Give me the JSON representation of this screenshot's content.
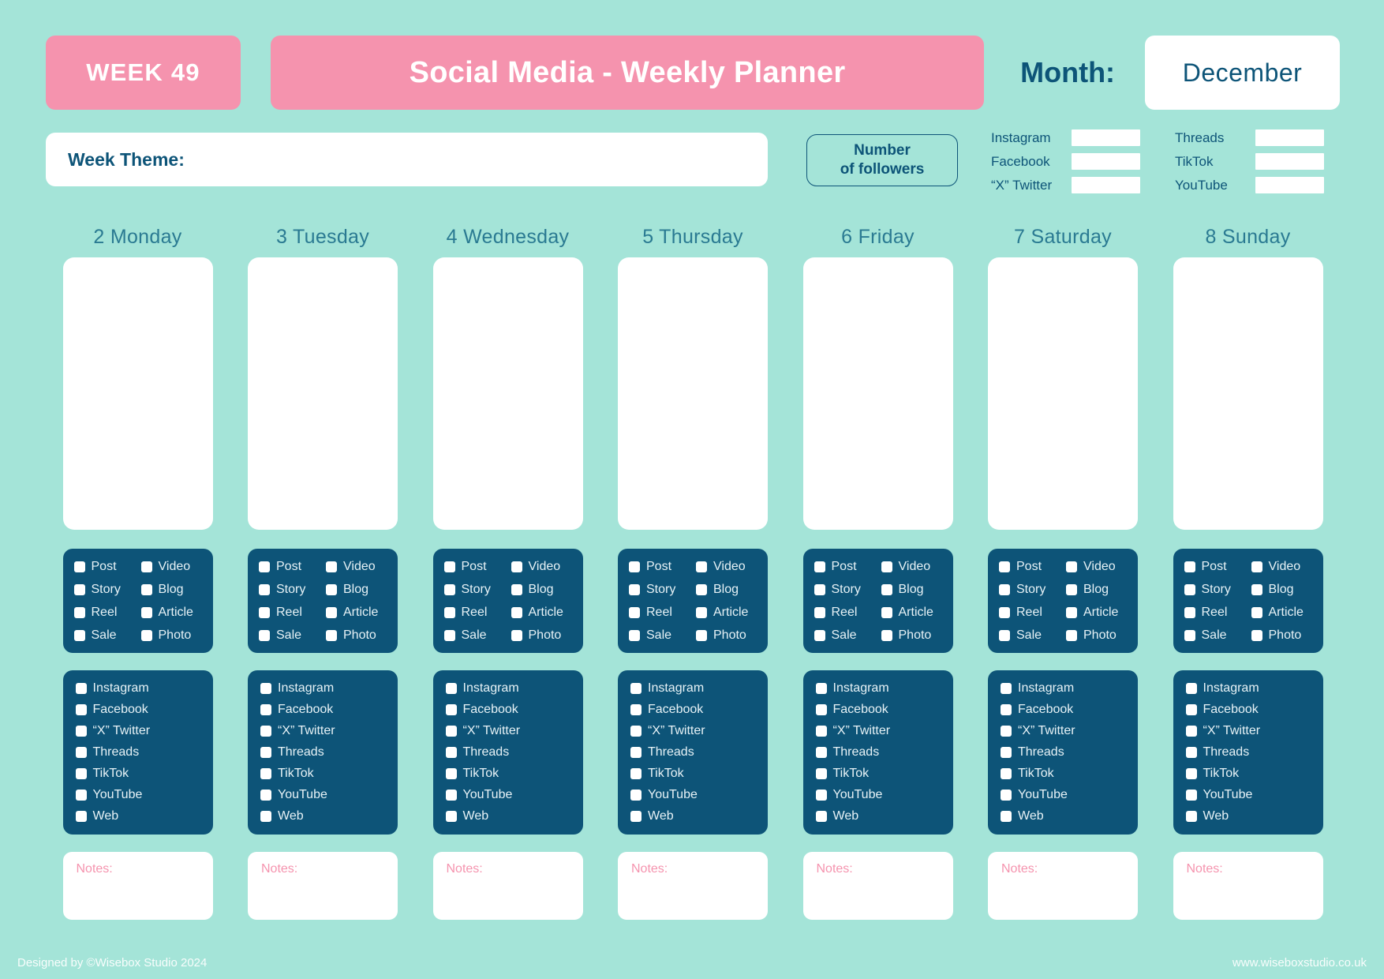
{
  "header": {
    "week_badge": "WEEK 49",
    "title": "Social Media - Weekly Planner",
    "month_label": "Month:",
    "month_value": "December"
  },
  "theme": {
    "label": "Week Theme:",
    "value": ""
  },
  "followers": {
    "badge_line1": "Number",
    "badge_line2": "of followers",
    "left_column": [
      {
        "name": "Instagram",
        "value": ""
      },
      {
        "name": "Facebook",
        "value": ""
      },
      {
        "name": "“X” Twitter",
        "value": ""
      }
    ],
    "right_column": [
      {
        "name": "Threads",
        "value": ""
      },
      {
        "name": "TikTok",
        "value": ""
      },
      {
        "name": "YouTube",
        "value": ""
      }
    ]
  },
  "days": [
    {
      "header": "2 Monday"
    },
    {
      "header": "3 Tuesday"
    },
    {
      "header": "4 Wednesday"
    },
    {
      "header": "5 Thursday"
    },
    {
      "header": "6 Friday"
    },
    {
      "header": "7 Saturday"
    },
    {
      "header": "8 Sunday"
    }
  ],
  "content_types": [
    "Post",
    "Video",
    "Story",
    "Blog",
    "Reel",
    "Article",
    "Sale",
    "Photo"
  ],
  "platforms": [
    "Instagram",
    "Facebook",
    "“X” Twitter",
    "Threads",
    "TikTok",
    "YouTube",
    "Web"
  ],
  "notes_label": "Notes:",
  "footer": {
    "left": "Designed by ©Wisebox Studio 2024",
    "right": "www.wiseboxstudio.co.uk"
  },
  "colors": {
    "background": "#a4e4d8",
    "pink": "#f593ae",
    "dark_blue": "#0d5478",
    "white": "#ffffff",
    "day_header": "#2a7a92"
  }
}
